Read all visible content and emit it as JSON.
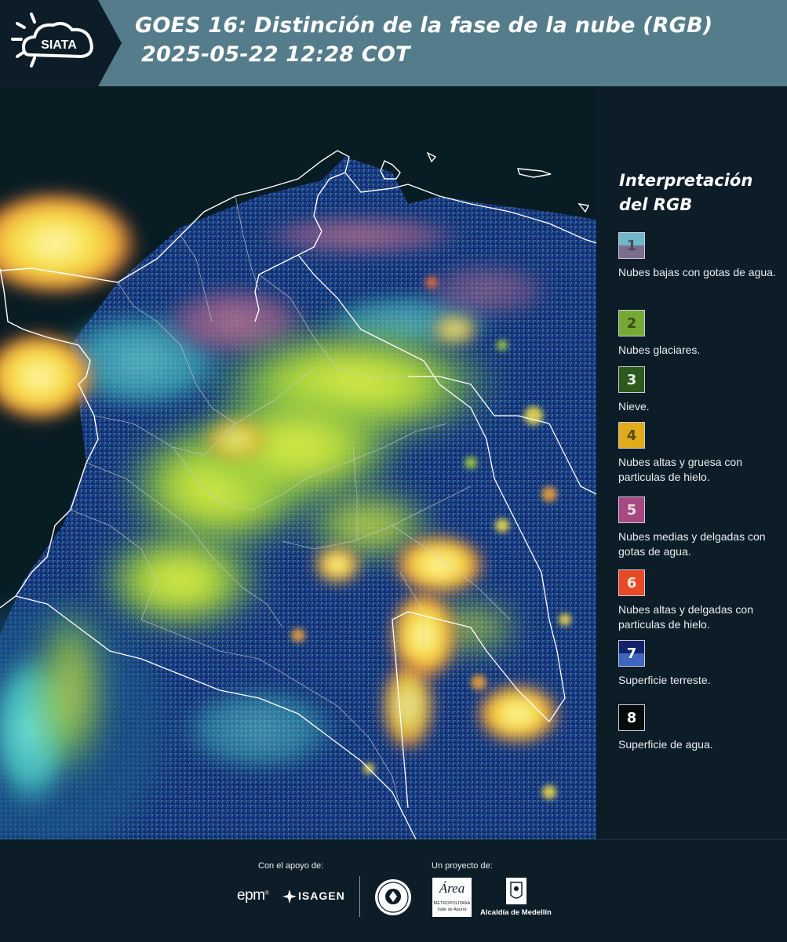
{
  "header": {
    "logo_text": "SIATA",
    "title_line1": "GOES 16: Distinción de la fase de la nube (RGB)",
    "title_line2": "2025-05-22 12:28 COT"
  },
  "legend": {
    "title_line1": "Interpretación",
    "title_line2": "del RGB",
    "items": [
      {
        "num": "1",
        "label": "Nubes bajas con gotas de agua.",
        "color_top": "#6fb8c8",
        "color_bottom": "#7c6e8c",
        "num_color": "#4a4a55"
      },
      {
        "num": "2",
        "label": "Nubes glaciares.",
        "color_top": "#78a834",
        "color_bottom": "#78a834",
        "num_color": "#3c4a20"
      },
      {
        "num": "3",
        "label": "Nieve.",
        "color_top": "#2d5a1c",
        "color_bottom": "#2d5a1c",
        "num_color": "#e8eef2"
      },
      {
        "num": "4",
        "label": "Nubes altas y gruesa con particulas de hielo.",
        "color_top": "#e0ac18",
        "color_bottom": "#e0ac18",
        "num_color": "#5a4a18"
      },
      {
        "num": "5",
        "label": "Nubes medias y delgadas con gotas de agua.",
        "color_top": "#a84880",
        "color_bottom": "#a84880",
        "num_color": "#e8dde6"
      },
      {
        "num": "6",
        "label": "Nubes altas y delgadas con particulas de hielo.",
        "color_top": "#e84a26",
        "color_bottom": "#e84a26",
        "num_color": "#f5e8e0"
      },
      {
        "num": "7",
        "label": "Superficie terreste.",
        "color_top": "#13226a",
        "color_bottom": "#3e66c0",
        "num_color": "#ffffff"
      },
      {
        "num": "8",
        "label": "Superficie de agua.",
        "color_top": "#050d0a",
        "color_bottom": "#050d0a",
        "num_color": "#ffffff"
      }
    ]
  },
  "footer": {
    "support_label": "Con el apoyo de:",
    "project_label": "Un proyecto de:",
    "epm": "epm",
    "epm_mark": "®",
    "isagen": "ISAGEN",
    "area_logo": "Área",
    "area_sub1": "METROPOLITANA",
    "area_sub2": "Valle de Aburrá",
    "alcaldia": "Alcaldía de Medellín"
  },
  "colors": {
    "header_bg": "#557c8a",
    "page_bg": "#0d1d28",
    "cloud_yellow": "#f5e35a",
    "cloud_green": "#9bd13a",
    "surface_blue": "#1d3a8a",
    "low_cloud_cyan": "#54d0c8"
  }
}
